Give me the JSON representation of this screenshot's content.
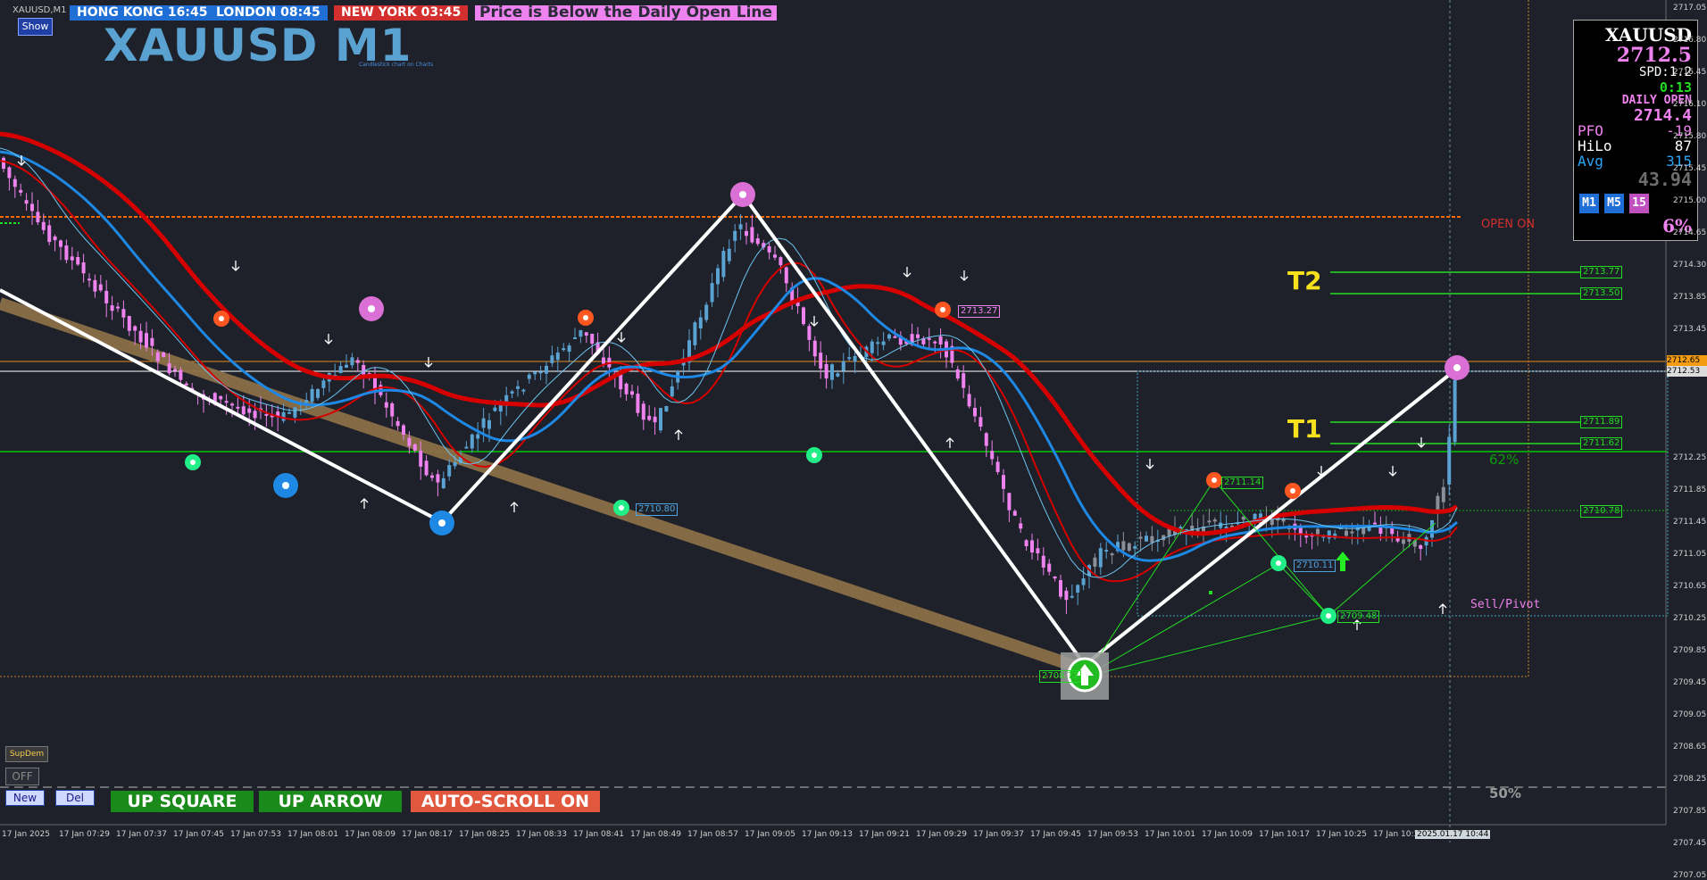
{
  "window": {
    "symbol_timeframe": "XAUUSD,M1",
    "show_button": "Show"
  },
  "clocks": [
    {
      "label": "HONG KONG 16:45",
      "bg": "#1f6fd6"
    },
    {
      "label": "LONDON  08:45",
      "bg": "#1f6fd6"
    },
    {
      "label": "NEW YORK 03:45",
      "bg": "#d32f2f"
    }
  ],
  "alert_message": "Price is Below the Daily Open Line",
  "chart_title": "XAUUSD M1",
  "chart_subtitle": "Candlestick chart on Charts",
  "info_panel": {
    "symbol": "XAUUSD",
    "price": "2712.5",
    "spread": "SPD:1.2",
    "timer": "0:13",
    "daily_open_label": "DAILY OPEN",
    "daily_open_value": "2714.4",
    "pfo_label": "PFO",
    "pfo_value": "-19",
    "hilo_label": "HiLo",
    "hilo_value": "87",
    "avg_label": "Avg",
    "avg_value": "315",
    "extra_value": "43.94",
    "timeframes": [
      "M1",
      "M5",
      "15"
    ],
    "percent": "6%"
  },
  "annotations": {
    "open_on": "OPEN ON",
    "t2": "T2",
    "t1": "T1",
    "fib_62": "62%",
    "fib_50": "50%",
    "sell_pivot": "Sell/Pivot"
  },
  "price_tags": [
    {
      "text": "2713.77",
      "color": "#22dd22"
    },
    {
      "text": "2713.50",
      "color": "#22dd22"
    },
    {
      "text": "2711.89",
      "color": "#22dd22"
    },
    {
      "text": "2711.62",
      "color": "#22dd22"
    },
    {
      "text": "2710.78",
      "color": "#22dd22"
    },
    {
      "text": "2713.27",
      "color": "#ee82ee"
    },
    {
      "text": "2710.80",
      "color": "#4fa3e0"
    },
    {
      "text": "2711.14",
      "color": "#22dd22"
    },
    {
      "text": "2710.11",
      "color": "#4fa3e0"
    },
    {
      "text": "2709.48",
      "color": "#22dd22"
    },
    {
      "text": "2708.72",
      "color": "#22dd22"
    }
  ],
  "price_axis": {
    "labels": [
      "2717.05",
      "2716.80",
      "2716.45",
      "2716.10",
      "2715.80",
      "2715.45",
      "2715.00",
      "2714.65",
      "2714.30",
      "2713.85",
      "2713.45",
      "2713.05",
      "2712.65",
      "2712.53",
      "2712.25",
      "2711.85",
      "2711.45",
      "2711.05",
      "2710.65",
      "2710.25",
      "2709.85",
      "2709.45",
      "2709.05",
      "2708.65",
      "2708.25",
      "2707.85",
      "2707.45",
      "2707.05"
    ],
    "current_price": "2712.65",
    "current_price_color": "#f39c12",
    "bid_price": "2712.53"
  },
  "time_axis": {
    "labels": [
      "17 Jan 2025",
      "17 Jan 07:29",
      "17 Jan 07:37",
      "17 Jan 07:45",
      "17 Jan 07:53",
      "17 Jan 08:01",
      "17 Jan 08:09",
      "17 Jan 08:17",
      "17 Jan 08:25",
      "17 Jan 08:33",
      "17 Jan 08:41",
      "17 Jan 08:49",
      "17 Jan 08:57",
      "17 Jan 09:05",
      "17 Jan 09:13",
      "17 Jan 09:21",
      "17 Jan 09:29",
      "17 Jan 09:37",
      "17 Jan 09:45",
      "17 Jan 09:53",
      "17 Jan 10:01",
      "17 Jan 10:09",
      "17 Jan 10:17",
      "17 Jan 10:25",
      "17 Jan 10:3"
    ],
    "cursor_time": "2025.01.17 10:44"
  },
  "controls": {
    "supdem": "SupDem",
    "off": "OFF",
    "new": "New",
    "del": "Del",
    "up_square": "UP SQUARE",
    "up_arrow": "UP ARROW",
    "auto_scroll": "AUTO-SCROLL ON"
  },
  "colors": {
    "background": "#1e2129",
    "bull_candle": "#5aa2d2",
    "bear_candle": "#ee82ee",
    "neutral_candle": "#8a8f99",
    "ma_slow": "#d60000",
    "ma_fast": "#1e88e5",
    "zigzag": "#ffffff",
    "trendline": "#8b6f47",
    "daily_open_line": "#ff6a00",
    "green_line": "#0a9e0a"
  }
}
